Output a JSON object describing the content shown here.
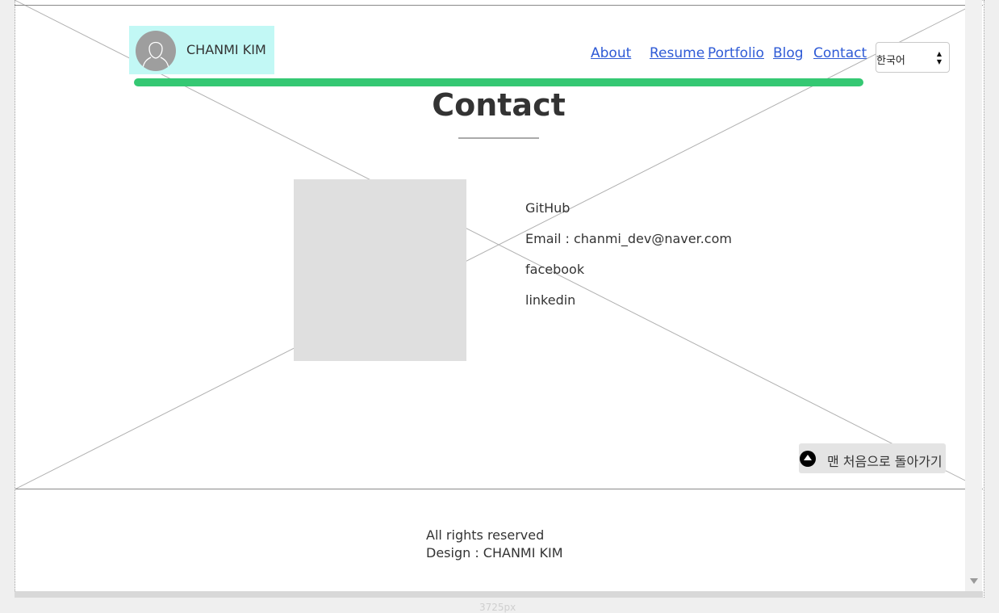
{
  "header": {
    "brand_name": "CHANMI KIM",
    "nav": [
      "About",
      "Resume",
      "Portfolio",
      "Blog",
      "Contact"
    ],
    "language": "한국어"
  },
  "main": {
    "title": "Contact",
    "links": [
      "GitHub",
      "Email : chanmi_dev@naver.com",
      "facebook",
      "linkedin"
    ]
  },
  "back_to_top": "맨 처음으로 돌아가기",
  "footer": {
    "line1": "All rights reserved",
    "line2": "Design : CHANMI KIM"
  },
  "canvas_height_label": "3725px",
  "colors": {
    "brand_bg": "#c2f8f5",
    "accent_bar": "#35c873",
    "link": "#2f5bd6",
    "placeholder": "#dfdfdf"
  }
}
